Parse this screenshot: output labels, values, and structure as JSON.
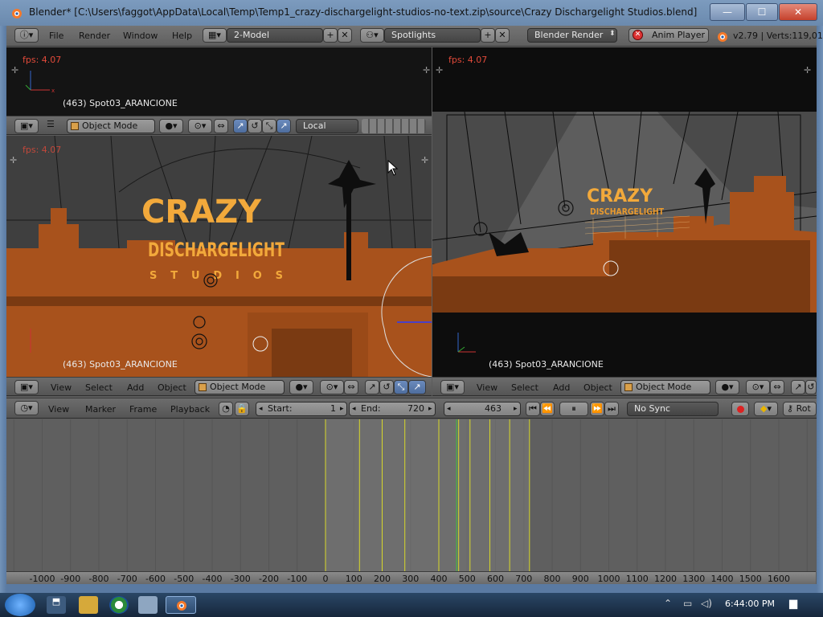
{
  "window": {
    "title": "Blender* [C:\\Users\\faggot\\AppData\\Local\\Temp\\Temp1_crazy-dischargelight-studios-no-text.zip\\source\\Crazy Dischargelight Studios.blend]",
    "minimize": "—",
    "maximize": "☐",
    "close": "✕"
  },
  "info_header": {
    "menus": [
      "File",
      "Render",
      "Window",
      "Help"
    ],
    "screen_layout": "2-Model",
    "scene": "Spotlights",
    "render_engine": "Blender Render",
    "anim_player": "Anim Player",
    "stats": "v2.79 | Verts:119,01"
  },
  "viewports": {
    "fps": "fps: 4.07",
    "object_label": "(463) Spot03_ARANCIONE",
    "mode": "Object Mode",
    "orientation": "Local",
    "menus": [
      "View",
      "Select",
      "Add",
      "Object"
    ]
  },
  "scene_text": {
    "logo_line1": "CRAZY",
    "logo_line2": "DISCHARGELIGHT",
    "logo_line3": "STUDIOS"
  },
  "timeline": {
    "menus": [
      "View",
      "Marker",
      "Frame",
      "Playback"
    ],
    "start_label": "Start:",
    "start_value": "1",
    "end_label": "End:",
    "end_value": "720",
    "current_frame": "463",
    "sync": "No Sync",
    "rot_label": "Rot",
    "ruler": [
      "-1000",
      "-900",
      "-800",
      "-700",
      "-600",
      "-500",
      "-400",
      "-300",
      "-200",
      "-100",
      "0",
      "100",
      "200",
      "300",
      "400",
      "500",
      "600",
      "700",
      "800",
      "900",
      "1000",
      "1100",
      "1200",
      "1300",
      "1400",
      "1500",
      "1600"
    ],
    "keyframe_lines": [
      0,
      120,
      200,
      280,
      400,
      470,
      510,
      580,
      650,
      720
    ]
  },
  "taskbar": {
    "clock": "6:44:00 PM"
  },
  "colors": {
    "accent": "#4e6d9e",
    "orange_scene": "#a8521c",
    "logo": "#f2a93b",
    "fps_red": "#e24a3a",
    "keyframe": "#d8d82a"
  }
}
